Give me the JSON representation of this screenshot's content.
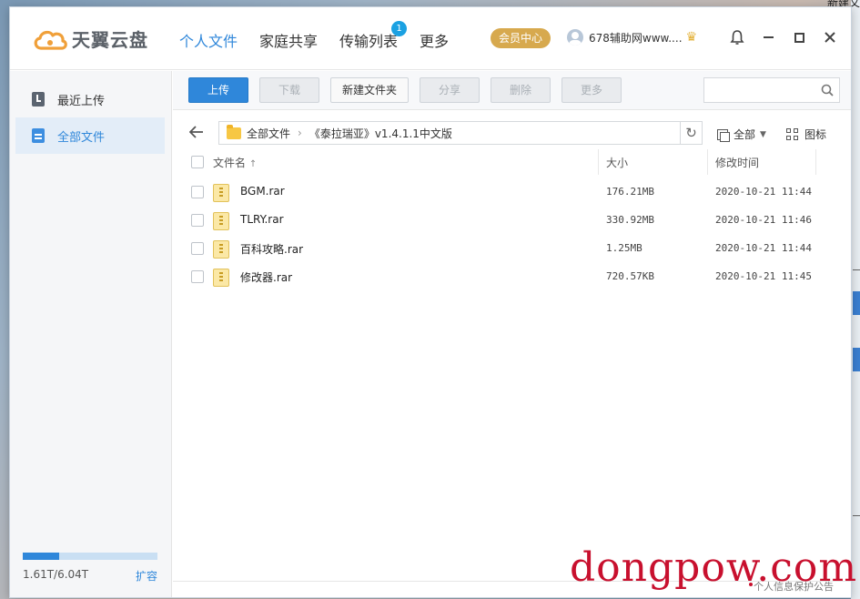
{
  "app": {
    "logo_text": "天翼云盘",
    "brand_color": "#2f87da",
    "accent_gold": "#d7a94e"
  },
  "nav": {
    "items": [
      {
        "label": "个人文件",
        "active": true
      },
      {
        "label": "家庭共享"
      },
      {
        "label": "传输列表",
        "badge": "1"
      },
      {
        "label": "更多"
      }
    ]
  },
  "header": {
    "vip_label": "会员中心",
    "username": "678辅助网www....",
    "icons": [
      "bell-icon",
      "minimize-icon",
      "maximize-icon",
      "close-icon"
    ]
  },
  "sidebar": {
    "items": [
      {
        "label": "最近上传",
        "icon": "recent-upload-icon"
      },
      {
        "label": "全部文件",
        "icon": "all-files-icon",
        "active": true
      }
    ],
    "quota_text": "1.61T/6.04T",
    "quota_used_fraction": 0.27,
    "expand_label": "扩容"
  },
  "toolbar": {
    "upload": "上传",
    "download": "下载",
    "new_folder": "新建文件夹",
    "share": "分享",
    "delete": "删除",
    "more": "更多",
    "search_placeholder": ""
  },
  "path": {
    "root": "全部文件",
    "current": "《泰拉瑞亚》v1.4.1.1中文版"
  },
  "filters": {
    "type": "全部",
    "view": "图标"
  },
  "table": {
    "headers": {
      "name": "文件名",
      "sort_indicator": "↑",
      "size": "大小",
      "modified": "修改时间"
    },
    "rows": [
      {
        "name": "BGM.rar",
        "size": "176.21MB",
        "modified": "2020-10-21 11:44"
      },
      {
        "name": "TLRY.rar",
        "size": "330.92MB",
        "modified": "2020-10-21 11:46"
      },
      {
        "name": "百科攻略.rar",
        "size": "1.25MB",
        "modified": "2020-10-21 11:44"
      },
      {
        "name": "修改器.rar",
        "size": "720.57KB",
        "modified": "2020-10-21 11:45"
      }
    ]
  },
  "overlay": {
    "watermark": "dongpow.com",
    "status_text": "个人信息保护公告"
  },
  "desktop": {
    "corner_text": "新建文"
  }
}
